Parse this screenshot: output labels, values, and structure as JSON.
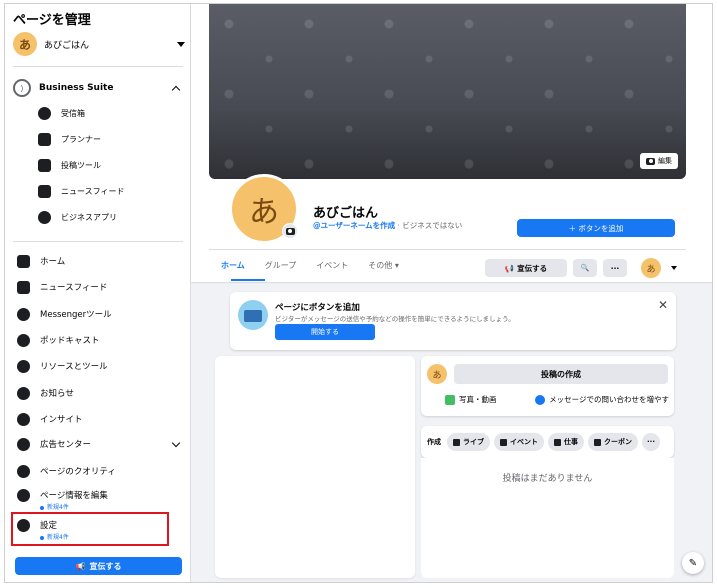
{
  "sidebar": {
    "title": "ページを管理",
    "page_name": "あびごはん",
    "avatar_char": "あ",
    "business_suite": {
      "label": "Business Suite",
      "items": [
        {
          "label": "受信箱",
          "icon": "inbox-icon"
        },
        {
          "label": "プランナー",
          "icon": "calendar-icon"
        },
        {
          "label": "投稿ツール",
          "icon": "publishing-tools-icon"
        },
        {
          "label": "ニュースフィード",
          "icon": "news-feed-icon"
        },
        {
          "label": "ビジネスアプリ",
          "icon": "business-apps-icon"
        }
      ]
    },
    "nav": [
      {
        "label": "ホーム",
        "icon": "home-icon"
      },
      {
        "label": "ニュースフィード",
        "icon": "news-feed-icon"
      },
      {
        "label": "Messengerツール",
        "icon": "messenger-icon"
      },
      {
        "label": "ポッドキャスト",
        "icon": "podcast-icon"
      },
      {
        "label": "リソースとツール",
        "icon": "info-icon"
      },
      {
        "label": "お知らせ",
        "icon": "bell-icon"
      },
      {
        "label": "インサイト",
        "icon": "insights-icon"
      },
      {
        "label": "広告センター",
        "icon": "megaphone-icon"
      },
      {
        "label": "ページのクオリティ",
        "icon": "shield-icon"
      },
      {
        "label": "ページ情報を編集",
        "icon": "pencil-icon",
        "sub": "新規4件"
      },
      {
        "label": "設定",
        "icon": "gear-icon",
        "sub": "新規4件"
      }
    ],
    "promote_label": "宣伝する"
  },
  "main": {
    "edit_cover_label": "編集",
    "profile_char": "あ",
    "page_name": "あびごはん",
    "username_link": "@ユーザーネームを作成",
    "page_category": " · ビジネスではない",
    "add_button_label": "＋ ボタンを追加",
    "tabs": [
      {
        "label": "ホーム"
      },
      {
        "label": "グループ"
      },
      {
        "label": "イベント"
      },
      {
        "label": "その他 ▾"
      }
    ],
    "actions": {
      "promote": "宣伝する",
      "search": "🔍",
      "more": "···",
      "avatar_char": "あ"
    },
    "cta": {
      "title": "ページにボタンを追加",
      "description": "ビジターがメッセージの送信や予約などの操作を簡単にできるようにしましょう。",
      "start_label": "開始する",
      "close": "✕"
    },
    "create_post": {
      "avatar_char": "あ",
      "button": "投稿の作成",
      "photo": "写真・動画",
      "message": "メッセージでの問い合わせを増やす"
    },
    "compose": {
      "label": "作成",
      "chips": [
        "ライブ",
        "イベント",
        "仕事",
        "クーポン"
      ],
      "more": "···"
    },
    "no_posts": "投稿はまだありません"
  }
}
